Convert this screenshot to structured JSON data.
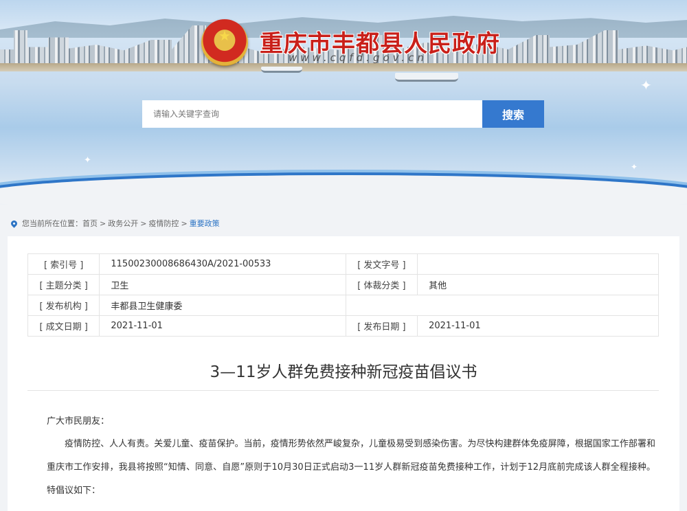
{
  "header": {
    "site_title": "重庆市丰都县人民政府",
    "site_domain": "www.cqfd.gov.cn"
  },
  "search": {
    "placeholder": "请输入关键字查询",
    "button_label": "搜索"
  },
  "breadcrumb": {
    "prefix": "您当前所在位置：",
    "items": [
      "首页",
      "政务公开",
      "疫情防控",
      "重要政策"
    ],
    "separator": ">"
  },
  "meta": {
    "index_no_label": "[ 索引号 ]",
    "index_no_value": "11500230008686430A/2021-00533",
    "doc_no_label": "[ 发文字号 ]",
    "doc_no_value": "",
    "topic_label": "[ 主题分类 ]",
    "topic_value": "卫生",
    "genre_label": "[ 体裁分类 ]",
    "genre_value": "其他",
    "agency_label": "[ 发布机构 ]",
    "agency_value": "丰都县卫生健康委",
    "created_label": "[ 成文日期 ]",
    "created_value": "2021-11-01",
    "published_label": "[ 发布日期 ]",
    "published_value": "2021-11-01"
  },
  "article": {
    "title": "3—11岁人群免费接种新冠疫苗倡议书",
    "salutation": "广大市民朋友：",
    "paragraph_1": "疫情防控、人人有责。关爱儿童、疫苗保护。当前，疫情形势依然严峻复杂，儿童极易受到感染伤害。为尽快构建群体免疫屏障，根据国家工作部署和重庆市工作安排，我县将按照“知情、同意、自愿”原则于10月30日正式启动3一11岁人群新冠疫苗免费接种工作，计划于12月底前完成该人群全程接种。特倡议如下："
  },
  "colors": {
    "accent_blue": "#3579cf",
    "title_red": "#c9201a"
  }
}
